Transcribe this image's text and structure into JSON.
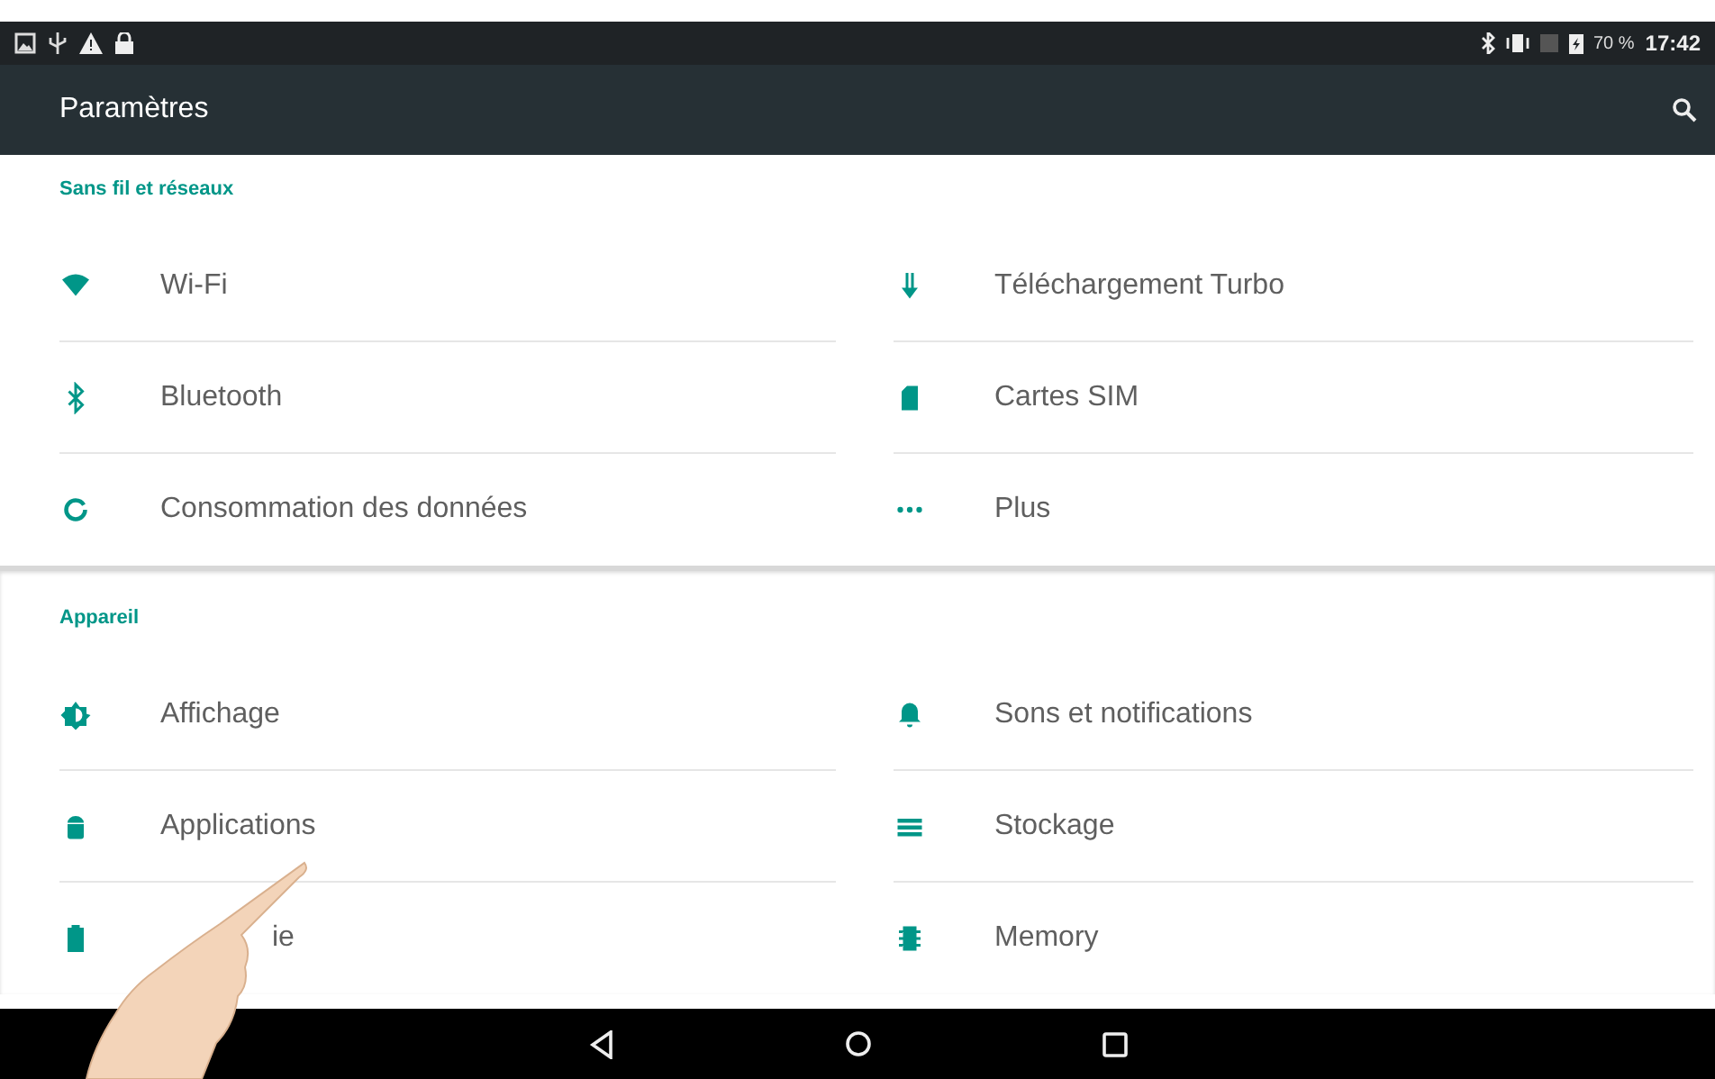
{
  "status_bar": {
    "battery": "70 %",
    "time": "17:42"
  },
  "toolbar": {
    "title": "Paramètres"
  },
  "sections": [
    {
      "title": "Sans fil et réseaux",
      "items": [
        {
          "label": "Wi-Fi"
        },
        {
          "label": "Téléchargement Turbo"
        },
        {
          "label": "Bluetooth"
        },
        {
          "label": "Cartes SIM"
        },
        {
          "label": "Consommation des données"
        },
        {
          "label": "Plus"
        }
      ]
    },
    {
      "title": "Appareil",
      "items": [
        {
          "label": "Affichage"
        },
        {
          "label": "Sons et notifications"
        },
        {
          "label": "Applications"
        },
        {
          "label": "Stockage"
        },
        {
          "label": "ie",
          "covered": true
        },
        {
          "label": "Memory"
        }
      ]
    }
  ]
}
